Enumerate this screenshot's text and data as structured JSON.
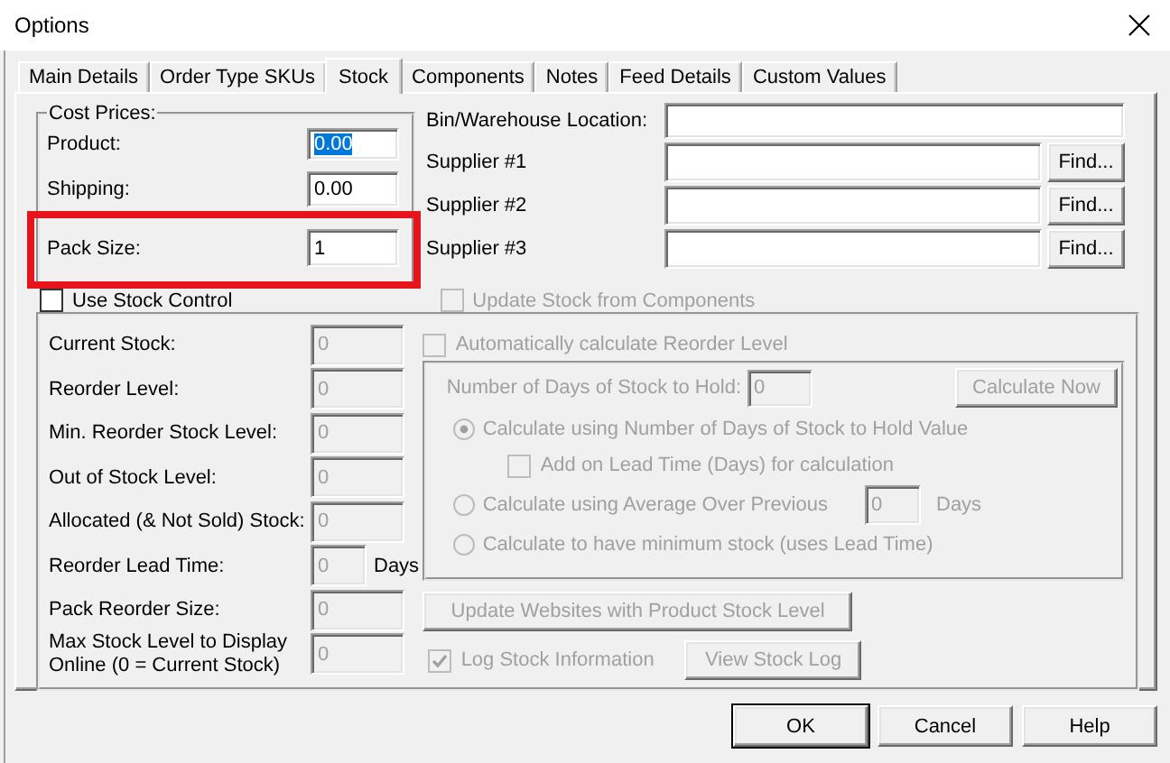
{
  "window": {
    "title": "Options"
  },
  "tabs": [
    {
      "label": "Main Details",
      "selected": false
    },
    {
      "label": "Order Type SKUs",
      "selected": false
    },
    {
      "label": "Stock",
      "selected": true
    },
    {
      "label": "Components",
      "selected": false
    },
    {
      "label": "Notes",
      "selected": false
    },
    {
      "label": "Feed Details",
      "selected": false
    },
    {
      "label": "Custom Values",
      "selected": false
    }
  ],
  "cost_prices": {
    "title": "Cost Prices:",
    "fields": [
      {
        "label": "Product:",
        "value": "0.00",
        "selected": true,
        "highlighted": false
      },
      {
        "label": "Shipping:",
        "value": "0.00",
        "selected": false,
        "highlighted": false
      },
      {
        "label": "Pack Size:",
        "value": "1",
        "selected": false,
        "highlighted": true
      }
    ]
  },
  "location": {
    "label": "Bin/Warehouse Location:"
  },
  "suppliers": [
    {
      "label": "Supplier #1",
      "button": "Find..."
    },
    {
      "label": "Supplier #2",
      "button": "Find..."
    },
    {
      "label": "Supplier #3",
      "button": "Find..."
    }
  ],
  "options": [
    {
      "label": "Use Stock Control",
      "checked": false,
      "disabled": false
    },
    {
      "label": "Update Stock from Components",
      "checked": false,
      "disabled": true
    }
  ],
  "stock": {
    "disabled": true,
    "fields": [
      {
        "label": "Current Stock:",
        "value": "0"
      },
      {
        "label": "Reorder Level:",
        "value": "0"
      },
      {
        "label": "Min. Reorder Stock Level:",
        "value": "0"
      },
      {
        "label": "Out of Stock Level:",
        "value": "0"
      },
      {
        "label": "Allocated (& Not Sold) Stock:",
        "value": "0"
      },
      {
        "label": "Reorder Lead Time:",
        "value": "0",
        "unit": "Days"
      },
      {
        "label": "Pack Reorder Size:",
        "value": "0"
      },
      {
        "label": "Max Stock Level to Display Online (0 = Current Stock)",
        "value": "0"
      }
    ],
    "auto_reorder": {
      "label": "Automatically calculate Reorder Level",
      "checked": false
    },
    "days_to_hold": {
      "label": "Number of Days of Stock to Hold:",
      "value": "0",
      "button": "Calculate Now"
    },
    "methods": [
      {
        "label": "Calculate using Number of Days of Stock to Hold Value",
        "selected": true,
        "option": {
          "label": "Add on Lead Time (Days) for calculation",
          "checked": false
        }
      },
      {
        "label": "Calculate using Average Over Previous",
        "selected": false,
        "value": "0",
        "unit": "Days"
      },
      {
        "label": "Calculate to have minimum stock (uses Lead Time)",
        "selected": false
      }
    ],
    "update_button": "Update Websites with Product Stock Level",
    "log": {
      "label": "Log Stock Information",
      "checked": true,
      "button": "View Stock Log"
    }
  },
  "buttons": [
    {
      "label": "OK",
      "default": true
    },
    {
      "label": "Cancel",
      "default": false
    },
    {
      "label": "Help",
      "default": false
    }
  ]
}
